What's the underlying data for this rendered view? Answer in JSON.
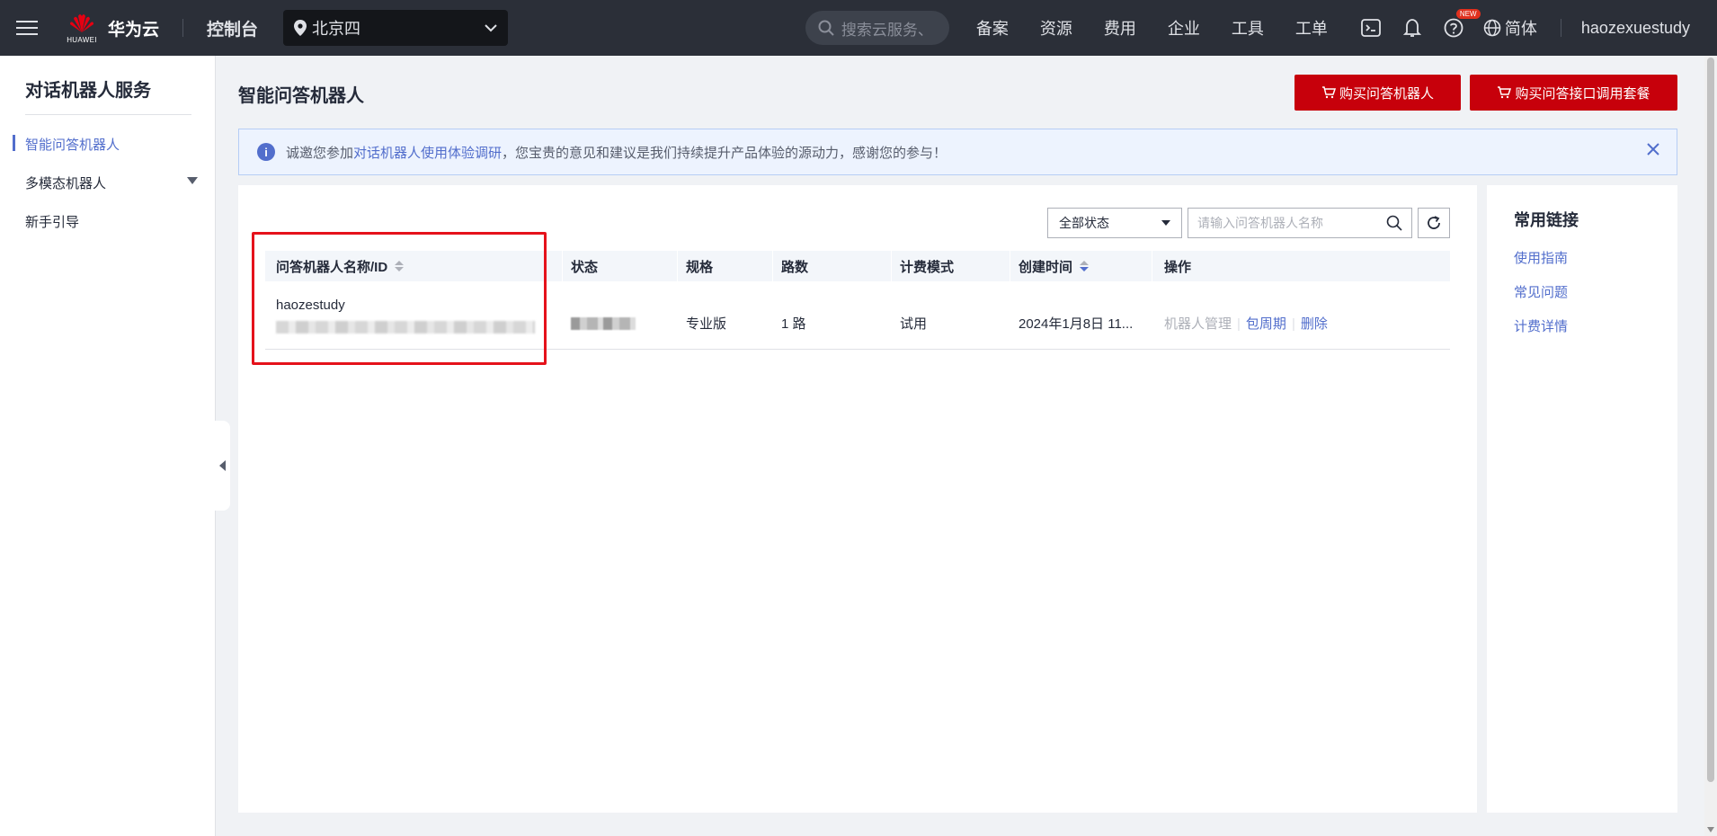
{
  "topbar": {
    "brand_sub": "HUAWEI",
    "brand_name": "华为云",
    "console": "控制台",
    "region": "北京四",
    "search_placeholder": "搜索云服务、",
    "nav": [
      "备案",
      "资源",
      "费用",
      "企业",
      "工具",
      "工单"
    ],
    "new_badge": "NEW",
    "language": "简体",
    "user": "haozexuestudy"
  },
  "sidebar": {
    "title": "对话机器人服务",
    "items": [
      {
        "label": "智能问答机器人"
      },
      {
        "label": "多模态机器人"
      },
      {
        "label": "新手引导"
      }
    ]
  },
  "main": {
    "title": "智能问答机器人",
    "buy_robot_label": "购买问答机器人",
    "buy_package_label": "购买问答接口调用套餐",
    "notice": {
      "prefix": "诚邀您参加",
      "link": "对话机器人使用体验调研",
      "suffix": "，您宝贵的意见和建议是我们持续提升产品体验的源动力，感谢您的参与！"
    },
    "filter": {
      "status": "全部状态",
      "search_placeholder": "请输入问答机器人名称"
    },
    "table": {
      "columns": [
        "问答机器人名称/ID",
        "状态",
        "规格",
        "路数",
        "计费模式",
        "创建时间",
        "操作"
      ],
      "rows": [
        {
          "name": "haozestudy",
          "spec": "专业版",
          "channels": "1 路",
          "billing": "试用",
          "created": "2024年1月8日 11...",
          "ops": {
            "manage": "机器人管理",
            "period": "包周期",
            "delete": "删除"
          }
        }
      ]
    }
  },
  "links": {
    "title": "常用链接",
    "items": [
      "使用指南",
      "常见问题",
      "计费详情"
    ]
  },
  "colors": {
    "accent": "#526ecc",
    "brand_red": "#c7000b",
    "topbar": "#2b2f38"
  }
}
